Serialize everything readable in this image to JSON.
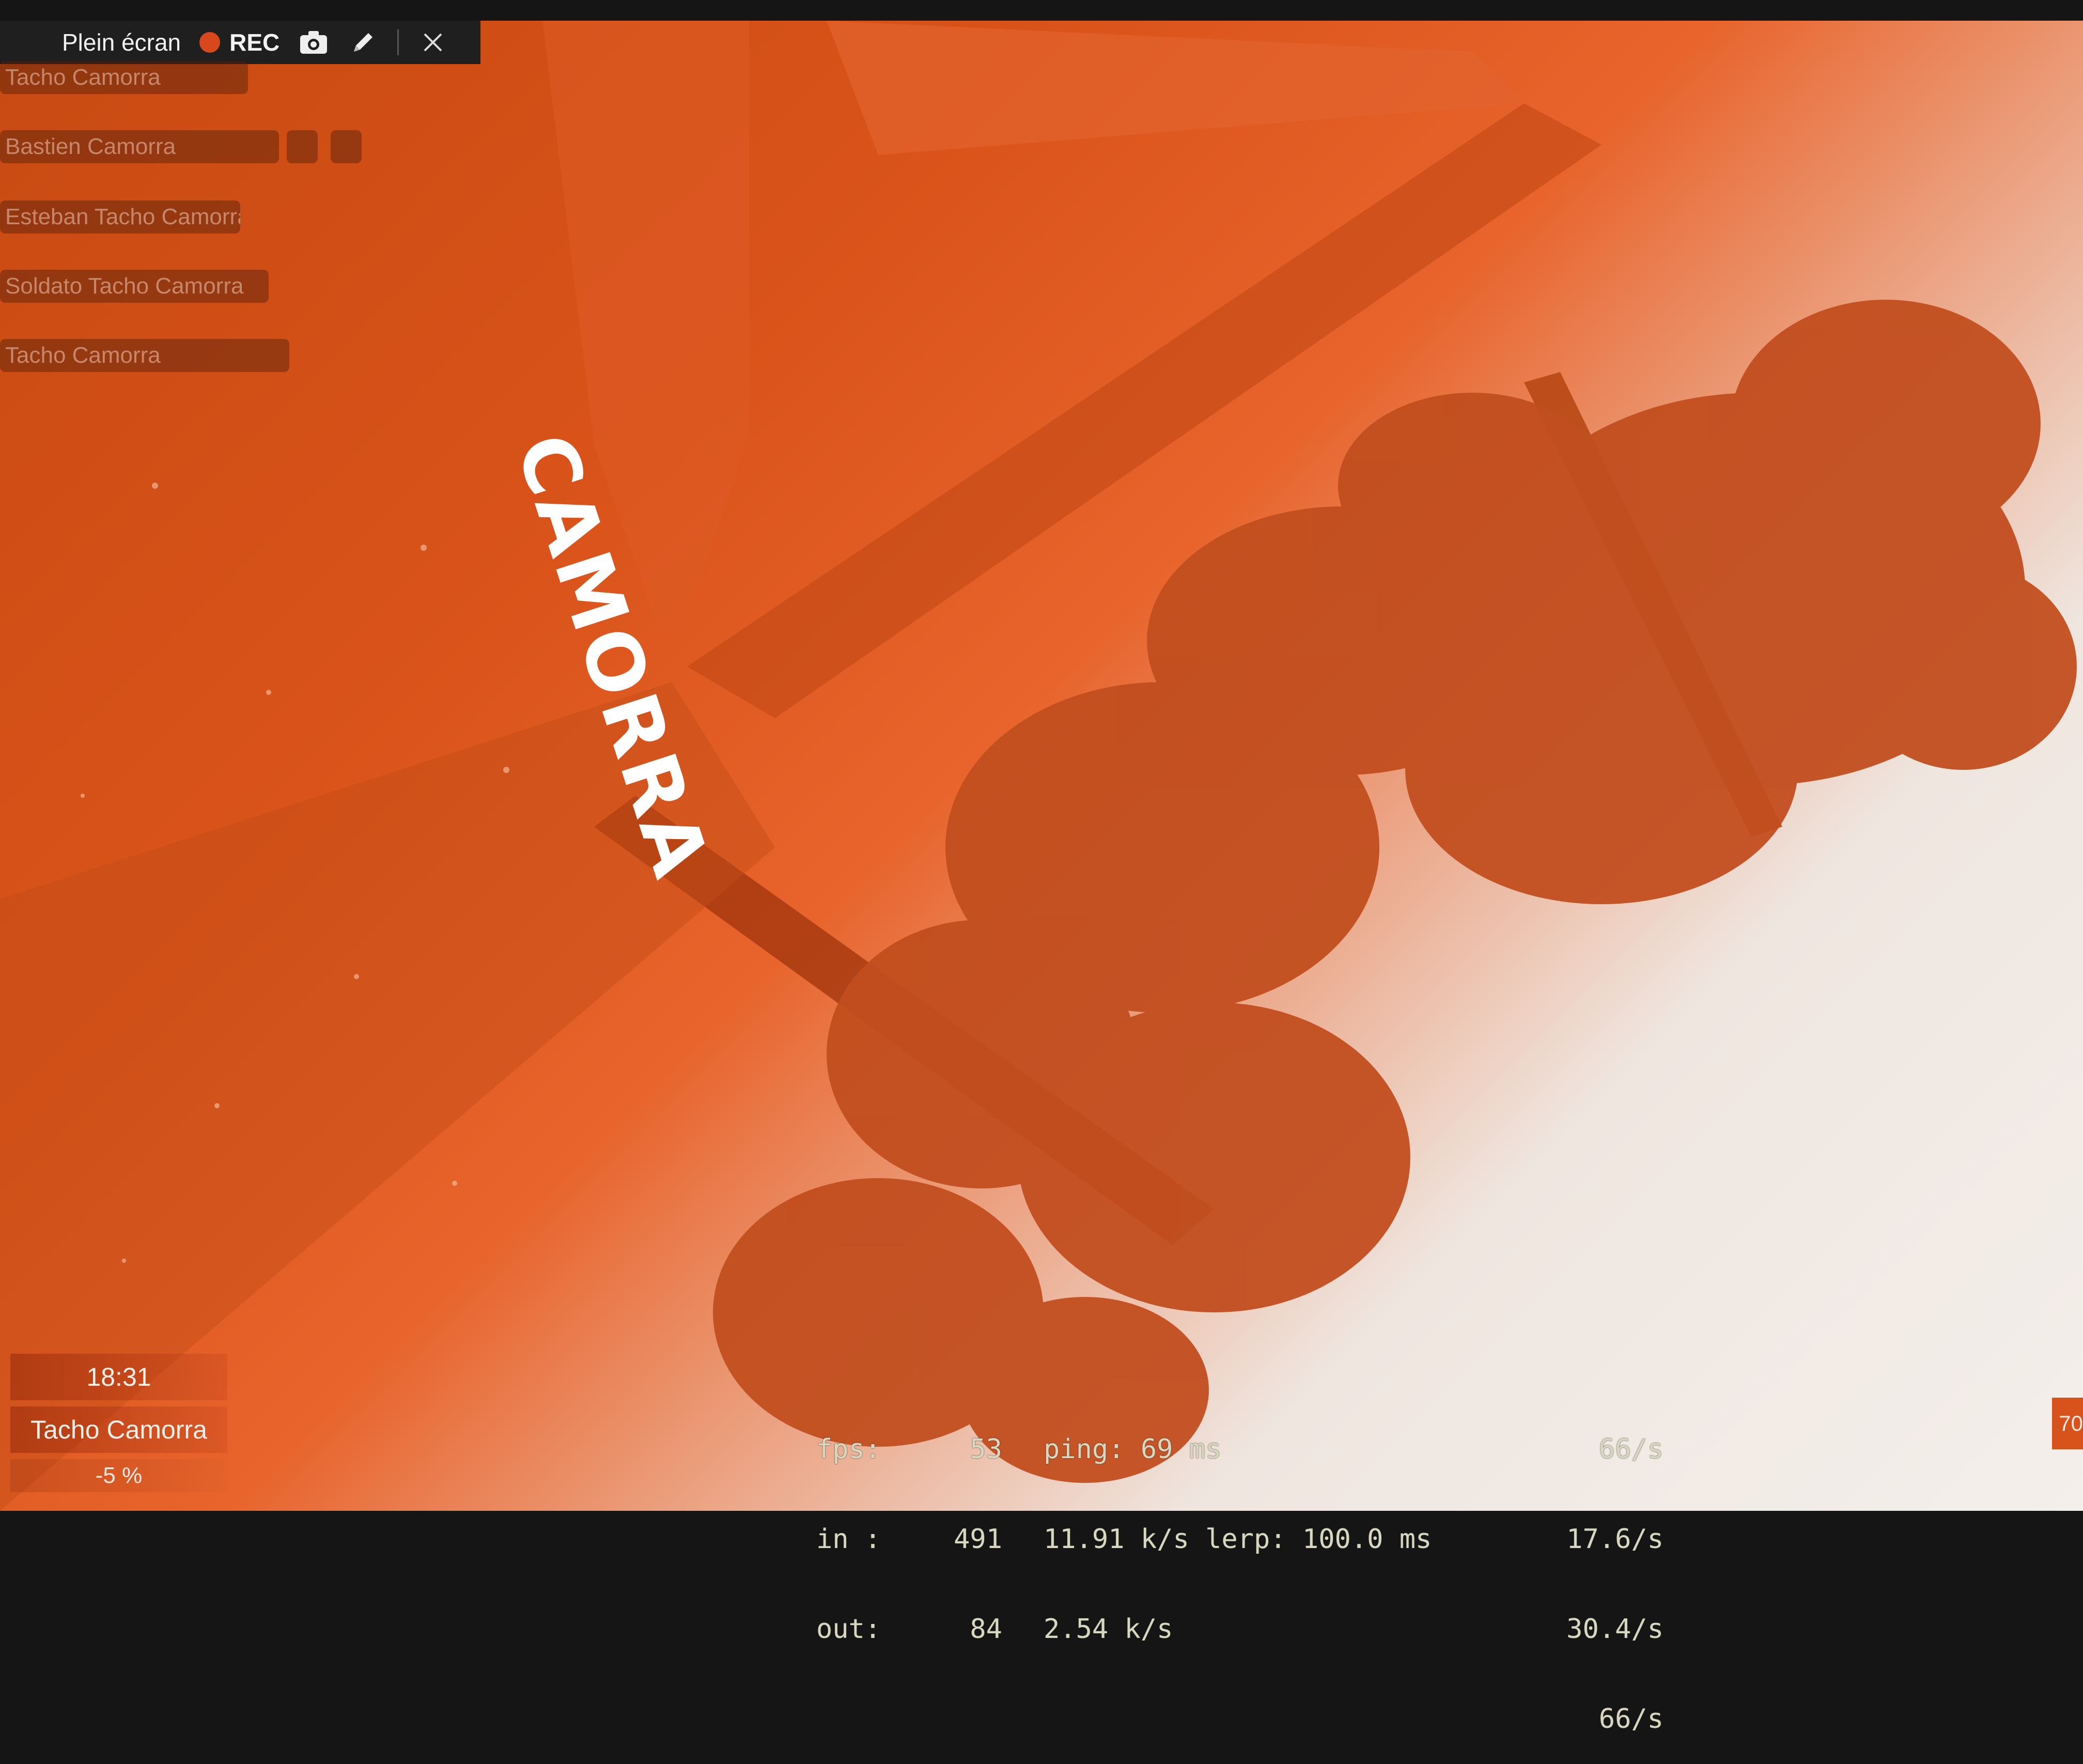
{
  "recorder_bar": {
    "fullscreen_label": "Plein écran",
    "rec_label": "REC",
    "camera_icon": "camera-icon",
    "pen_icon": "pencil-icon",
    "close_icon": "close-icon",
    "rec_color": "#d9481c"
  },
  "game_menu": {
    "items": [
      {
        "label": "Tacho Camorra"
      },
      {
        "label": "Bastien Camorra"
      },
      {
        "label": "Esteban Tacho Camorra"
      },
      {
        "label": "Soldato Tacho Camorra"
      },
      {
        "label": "Tacho Camorra"
      }
    ]
  },
  "scene": {
    "sign_text": "CAMORRA",
    "tint_color": "#d9531a",
    "sky_color": "#f2ece8"
  },
  "hud": {
    "time": "18:31",
    "player_name": "Tacho Camorra",
    "percent": "-5 %"
  },
  "net_graph": {
    "fps_label": "fps:",
    "fps_value": "53",
    "ping_text": "ping: 69 ms",
    "rate1": "66/s",
    "in_label": "in :",
    "in_value": "491",
    "in_rate": "11.91 k/s lerp: 100.0 ms",
    "rate2": "17.6/s",
    "out_label": "out:",
    "out_value": "84",
    "out_rate": "2.54 k/s",
    "rate3": "30.4/s",
    "rate4": "66/s"
  },
  "edge_badge": "70"
}
